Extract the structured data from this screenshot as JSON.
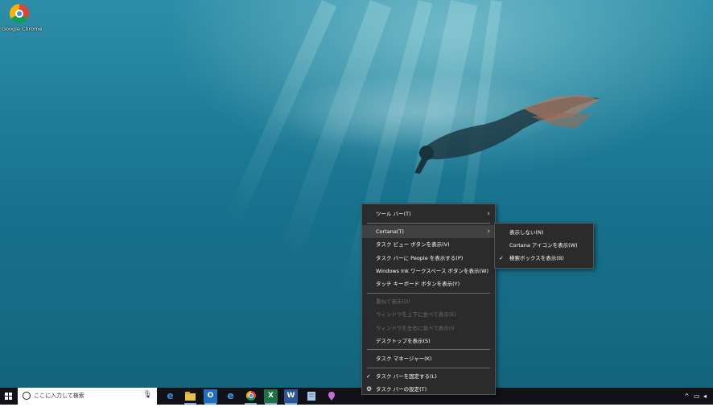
{
  "desktop": {
    "icons": [
      {
        "label": "Google Chrome",
        "icon": "chrome-icon"
      }
    ]
  },
  "context_menu": {
    "items": [
      {
        "label": "ツール バー(T)",
        "submenu": true
      },
      {
        "label": "Cortana(T)",
        "submenu": true,
        "highlighted": true
      },
      {
        "label": "タスク ビュー ボタンを表示(V)"
      },
      {
        "label": "タスク バーに People を表示する(P)"
      },
      {
        "label": "Windows Ink ワークスペース ボタンを表示(W)"
      },
      {
        "label": "タッチ キーボード ボタンを表示(Y)"
      },
      {
        "label": "重ねて表示(D)",
        "disabled": true
      },
      {
        "label": "ウィンドウを上下に並べて表示(E)",
        "disabled": true
      },
      {
        "label": "ウィンドウを左右に並べて表示(I)",
        "disabled": true
      },
      {
        "label": "デスクトップを表示(S)"
      },
      {
        "label": "タスク マネージャー(K)"
      },
      {
        "label": "タスク バーを固定する(L)",
        "checked": true
      },
      {
        "label": "タスク バーの設定(T)",
        "icon": "gear-icon"
      }
    ]
  },
  "cortana_submenu": {
    "items": [
      {
        "label": "表示しない(N)"
      },
      {
        "label": "Cortana アイコンを表示(W)"
      },
      {
        "label": "検索ボックスを表示(B)",
        "checked": true
      }
    ]
  },
  "taskbar": {
    "search_placeholder": "ここに入力して検索",
    "pinned": [
      {
        "name": "edge-icon",
        "glyph": "e",
        "color": "#3b8ede"
      },
      {
        "name": "file-explorer-icon",
        "glyph": "",
        "color": "#e8c04a"
      },
      {
        "name": "outlook-icon",
        "glyph": "O",
        "color": "#1f6fc1"
      },
      {
        "name": "internet-explorer-icon",
        "glyph": "e",
        "color": "#37a3e6"
      },
      {
        "name": "chrome-icon",
        "glyph": "",
        "color": "#db4437"
      },
      {
        "name": "excel-icon",
        "glyph": "X",
        "color": "#1e7145"
      },
      {
        "name": "word-icon",
        "glyph": "W",
        "color": "#2b579a"
      },
      {
        "name": "notepad-icon",
        "glyph": "",
        "color": "#a9c7e8"
      },
      {
        "name": "paint-3d-icon",
        "glyph": "",
        "color": "#c86dd7"
      }
    ],
    "tray": {
      "chevron": "^"
    }
  },
  "colors": {
    "menu_bg": "#2b2b2b",
    "menu_highlight": "#414141",
    "taskbar": "#101218"
  }
}
